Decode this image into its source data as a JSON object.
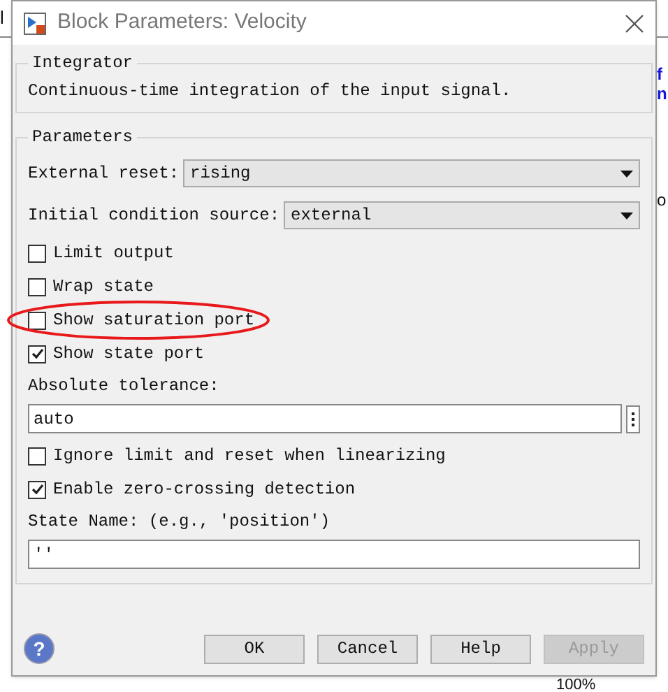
{
  "background": {
    "texts": [
      "l",
      "f",
      "n",
      "o",
      "100%"
    ]
  },
  "window": {
    "title": "Block Parameters: Velocity"
  },
  "description_group": {
    "title": "Integrator",
    "text": "Continuous-time integration of the input signal."
  },
  "parameters": {
    "title": "Parameters",
    "items": [
      {
        "kind": "dropdown",
        "label": "External reset:",
        "value": "rising"
      },
      {
        "kind": "dropdown",
        "label": "Initial condition source:",
        "value": "external"
      },
      {
        "kind": "checkbox",
        "label": "Limit output",
        "checked": false,
        "circled": false
      },
      {
        "kind": "checkbox",
        "label": "Wrap state",
        "checked": false,
        "circled": false
      },
      {
        "kind": "checkbox",
        "label": "Show saturation port",
        "checked": false,
        "circled": true
      },
      {
        "kind": "checkbox",
        "label": "Show state port",
        "checked": true,
        "circled": false
      },
      {
        "kind": "textfield",
        "label": "Absolute tolerance:",
        "value": "auto",
        "more": true
      },
      {
        "kind": "checkbox",
        "label": "Ignore limit and reset when linearizing",
        "checked": false,
        "circled": false
      },
      {
        "kind": "checkbox",
        "label": "Enable zero-crossing detection",
        "checked": true,
        "circled": false
      },
      {
        "kind": "textfield",
        "label": "State Name: (e.g., 'position')",
        "value": "''",
        "more": false
      }
    ]
  },
  "help": {
    "symbol": "?"
  },
  "buttons": [
    {
      "label": "OK",
      "disabled": false
    },
    {
      "label": "Cancel",
      "disabled": false
    },
    {
      "label": "Help",
      "disabled": false
    },
    {
      "label": "Apply",
      "disabled": true
    }
  ]
}
